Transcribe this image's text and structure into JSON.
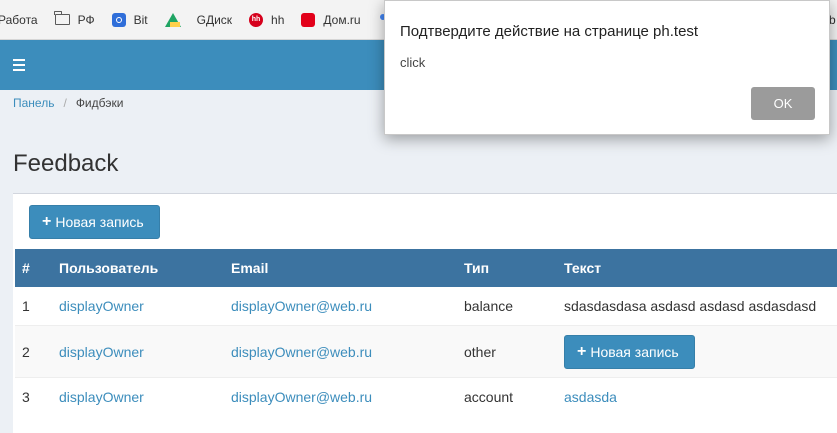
{
  "bookmarks": [
    {
      "label": "Работа",
      "icon": "folder-icon"
    },
    {
      "label": "РФ",
      "icon": "folder-icon"
    },
    {
      "label": "Bit",
      "icon": "bit-icon"
    },
    {
      "label": "GДиск",
      "icon": "google-drive-icon"
    },
    {
      "label": "hh",
      "icon": "hh-icon"
    },
    {
      "label": "Дом.ru",
      "icon": "domru-icon"
    }
  ],
  "bookmarks_trailing": "b",
  "header": {
    "menu_icon": "hamburger-icon"
  },
  "breadcrumb": {
    "items": [
      "Панель",
      "Фидбэки"
    ]
  },
  "page": {
    "title": "Feedback"
  },
  "toolbar": {
    "new_label": "Новая запись"
  },
  "table": {
    "headers": [
      "#",
      "Пользователь",
      "Email",
      "Тип",
      "Текст"
    ],
    "rows": [
      {
        "id": "1",
        "user": "displayOwner",
        "email": "displayOwner@web.ru",
        "type": "balance",
        "text": "sdasdasdasa asdasd asdasd asdasdasd"
      },
      {
        "id": "2",
        "user": "displayOwner",
        "email": "displayOwner@web.ru",
        "type": "other",
        "text_button": "Новая запись"
      },
      {
        "id": "3",
        "user": "displayOwner",
        "email": "displayOwner@web.ru",
        "type": "account",
        "text_link": "asdasda"
      }
    ]
  },
  "dialog": {
    "title": "Подтвердите действие на странице ph.test",
    "message": "click",
    "ok_label": "OK"
  },
  "colors": {
    "primary": "#3c8dbc",
    "table_header": "#3c73a0",
    "background": "#ecf0f5"
  }
}
